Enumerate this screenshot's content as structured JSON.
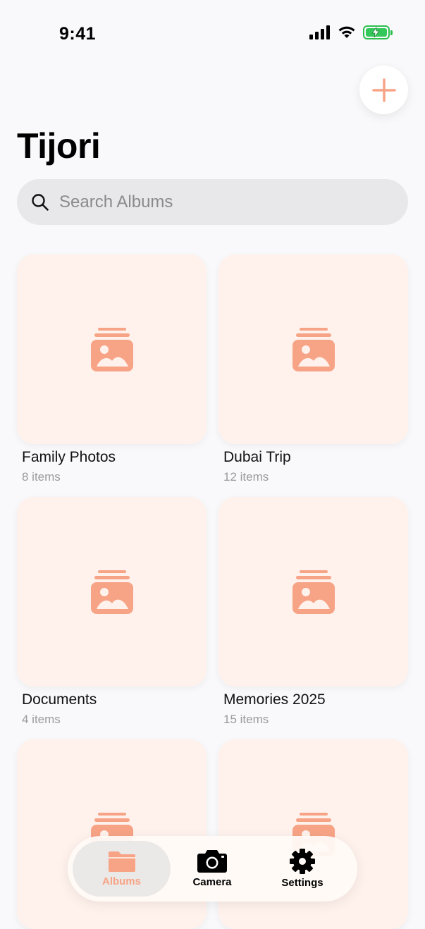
{
  "status_bar": {
    "time": "9:41"
  },
  "header": {
    "title": "Tijori"
  },
  "search": {
    "placeholder": "Search Albums",
    "value": ""
  },
  "albums": [
    {
      "name": "Family Photos",
      "count": "8 items"
    },
    {
      "name": "Dubai Trip",
      "count": "12 items"
    },
    {
      "name": "Documents",
      "count": "4 items"
    },
    {
      "name": "Memories 2025",
      "count": "15 items"
    },
    {
      "name": "",
      "count": ""
    },
    {
      "name": "",
      "count": ""
    }
  ],
  "tab_bar": {
    "tabs": [
      {
        "label": "Albums",
        "icon": "folder-icon",
        "active": true
      },
      {
        "label": "Camera",
        "icon": "camera-icon",
        "active": false
      },
      {
        "label": "Settings",
        "icon": "gear-icon",
        "active": false
      }
    ]
  },
  "colors": {
    "accent": "#f7a386",
    "thumb_background": "#fff2ec",
    "page_background": "#f9f9fb",
    "battery": "#34c759"
  },
  "icons": {
    "add": "plus-icon",
    "search": "search-icon",
    "album_placeholder": "photo-stack-icon"
  }
}
